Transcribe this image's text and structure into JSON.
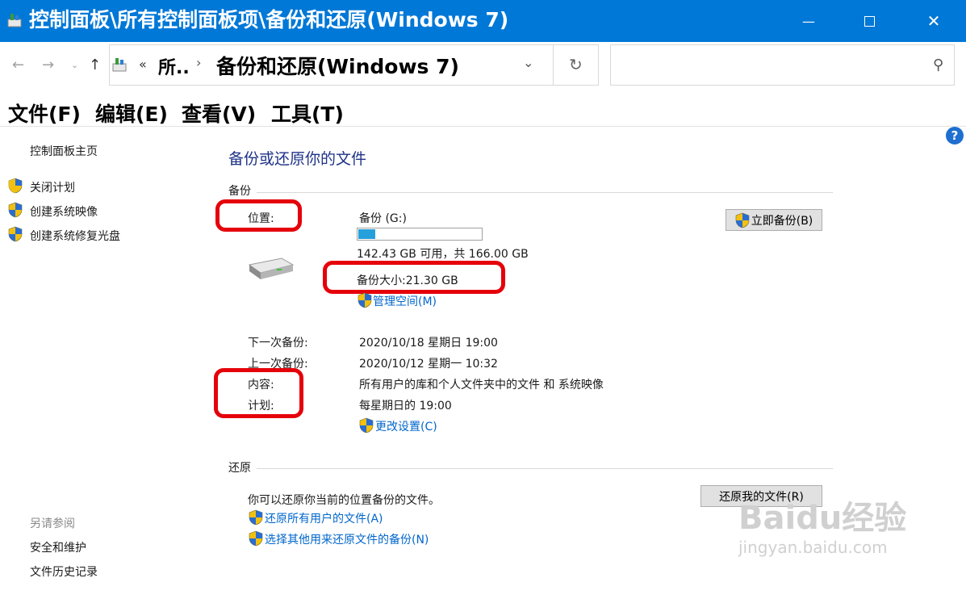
{
  "window": {
    "title": "控制面板\\所有控制面板项\\备份和还原(Windows 7)",
    "colors": {
      "titlebar": "#0078d7",
      "link": "#0066cc",
      "heading": "#1e3287",
      "highlight": "#e5000a",
      "progress": "#26a0da"
    }
  },
  "address": {
    "overflow": "«",
    "crumb1": "所..",
    "separator": "›",
    "crumb2": "备份和还原(Windows 7)",
    "search_placeholder": ""
  },
  "menu": [
    "文件(F)",
    "编辑(E)",
    "查看(V)",
    "工具(T)"
  ],
  "sidebar": {
    "home": "控制面板主页",
    "tasks": [
      "关闭计划",
      "创建系统映像",
      "创建系统修复光盘"
    ],
    "see_also_title": "另请参阅",
    "see_also": [
      "安全和维护",
      "文件历史记录"
    ]
  },
  "main": {
    "heading": "备份或还原你的文件",
    "backup": {
      "section_title": "备份",
      "location_label": "位置:",
      "location_value": "备份 (G:)",
      "disk_used_fraction": 0.14,
      "space_text": "142.43 GB 可用，共 166.00 GB",
      "backup_size": "备份大小:21.30 GB",
      "manage_space": "管理空间(M)",
      "backup_now": "立即备份(B)",
      "next_label": "下一次备份:",
      "next_value": "2020/10/18 星期日 19:00",
      "last_label": "上一次备份:",
      "last_value": "2020/10/12 星期一 10:32",
      "contents_label": "内容:",
      "contents_value": "所有用户的库和个人文件夹中的文件 和 系统映像",
      "schedule_label": "计划:",
      "schedule_value": "每星期日的 19:00",
      "change_settings": "更改设置(C)"
    },
    "restore": {
      "section_title": "还原",
      "description": "你可以还原你当前的位置备份的文件。",
      "restore_my_files": "还原我的文件(R)",
      "restore_all_users": "还原所有用户的文件(A)",
      "select_other": "选择其他用来还原文件的备份(N)"
    }
  },
  "watermark": {
    "brand": "Baidu经验",
    "url": "jingyan.baidu.com"
  },
  "icons": [
    "control-panel-icon",
    "minimize-icon",
    "maximize-icon",
    "close-icon",
    "back-icon",
    "forward-icon",
    "recent-icon",
    "up-icon",
    "dropdown-icon",
    "refresh-icon",
    "search-icon",
    "help-icon",
    "uac-shield-icon",
    "drive-icon"
  ]
}
